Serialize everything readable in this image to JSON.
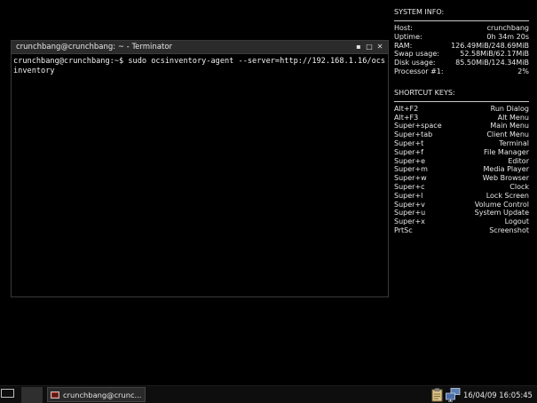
{
  "system_info": {
    "heading": "SYSTEM INFO:",
    "rows": [
      {
        "label": "Host:",
        "value": "crunchbang"
      },
      {
        "label": "Uptime:",
        "value": "0h 34m 20s"
      },
      {
        "label": "RAM:",
        "value": "126.49MiB/248.69MiB"
      },
      {
        "label": "Swap usage:",
        "value": "52.58MiB/62.17MiB"
      },
      {
        "label": "Disk usage:",
        "value": "85.50MiB/124.34MiB"
      },
      {
        "label": "Processor #1:",
        "value": "2%"
      }
    ]
  },
  "shortcut_keys": {
    "heading": "SHORTCUT KEYS:",
    "rows": [
      {
        "key": "Alt+F2",
        "action": "Run Dialog"
      },
      {
        "key": "Alt+F3",
        "action": "Alt Menu"
      },
      {
        "key": "Super+space",
        "action": "Main Menu"
      },
      {
        "key": "Super+tab",
        "action": "Client Menu"
      },
      {
        "key": "Super+t",
        "action": "Terminal"
      },
      {
        "key": "Super+f",
        "action": "File Manager"
      },
      {
        "key": "Super+e",
        "action": "Editor"
      },
      {
        "key": "Super+m",
        "action": "Media Player"
      },
      {
        "key": "Super+w",
        "action": "Web Browser"
      },
      {
        "key": "Super+c",
        "action": "Clock"
      },
      {
        "key": "Super+l",
        "action": "Lock Screen"
      },
      {
        "key": "Super+v",
        "action": "Volume Control"
      },
      {
        "key": "Super+u",
        "action": "System Update"
      },
      {
        "key": "Super+x",
        "action": "Logout"
      },
      {
        "key": "PrtSc",
        "action": "Screenshot"
      }
    ]
  },
  "terminal": {
    "title": "crunchbang@crunchbang: ~ - Terminator",
    "prompt": "crunchbang@crunchbang:~$ ",
    "command": "sudo ocsinventory-agent --server=http://192.168.1.16/ocsinventory",
    "buttons": {
      "minimize": "▪",
      "maximize": "□",
      "close": "✕"
    }
  },
  "taskbar": {
    "task_label": "crunchbang@crunc...",
    "clock": "16/04/09 16:05:45"
  },
  "colors": {
    "background": "#000000",
    "text": "#e8e8e8",
    "titlebar": "#2b2b2b",
    "terminal_icon": "#c0392b"
  }
}
